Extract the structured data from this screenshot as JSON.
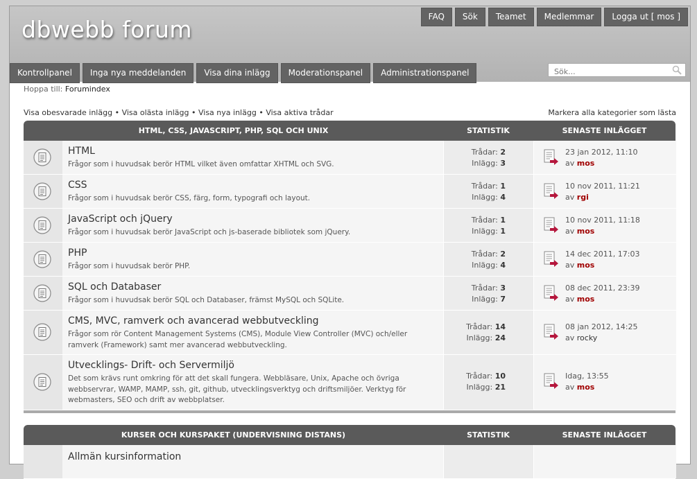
{
  "site": {
    "title": "dbwebb forum"
  },
  "top_nav": [
    {
      "label": "FAQ"
    },
    {
      "label": "Sök"
    },
    {
      "label": "Teamet"
    },
    {
      "label": "Medlemmar"
    },
    {
      "label": "Logga ut [ mos ]"
    }
  ],
  "tabs": [
    {
      "label": "Kontrollpanel"
    },
    {
      "label": "Inga nya meddelanden"
    },
    {
      "label": "Visa dina inlägg"
    },
    {
      "label": "Moderationspanel"
    },
    {
      "label": "Administrationspanel"
    }
  ],
  "search": {
    "placeholder": "Sök..."
  },
  "jump": {
    "prefix": "Hoppa till:",
    "link": "Forumindex"
  },
  "quick_links": [
    {
      "label": "Visa obesvarade inlägg"
    },
    {
      "label": "Visa olästa inlägg"
    },
    {
      "label": "Visa nya inlägg"
    },
    {
      "label": "Visa aktiva trådar"
    }
  ],
  "separator": "•",
  "mark_all": "Markera alla kategorier som lästa",
  "stat_labels": {
    "threads": "Trådar:",
    "posts": "Inlägg:",
    "by": "av"
  },
  "sections": [
    {
      "title": "HTML, CSS, JAVASCRIPT, PHP, SQL OCH UNIX",
      "stat_header": "STATISTIK",
      "last_header": "SENASTE INLÄGGET",
      "forums": [
        {
          "title": "HTML",
          "desc": "Frågor som i huvudsak berör HTML vilket även omfattar XHTML och SVG.",
          "threads": "2",
          "posts": "3",
          "last_date": "23 jan 2012, 11:10",
          "last_user": "mos"
        },
        {
          "title": "CSS",
          "desc": "Frågor som i huvudsak berör CSS, färg, form, typografi och layout.",
          "threads": "1",
          "posts": "4",
          "last_date": "10 nov 2011, 11:21",
          "last_user": "rgi"
        },
        {
          "title": "JavaScript och jQuery",
          "desc": "Frågor som i huvudsak berör JavaScript och js-baserade bibliotek som jQuery.",
          "threads": "1",
          "posts": "1",
          "last_date": "10 nov 2011, 11:18",
          "last_user": "mos"
        },
        {
          "title": "PHP",
          "desc": "Frågor som i huvudsak berör PHP.",
          "threads": "2",
          "posts": "4",
          "last_date": "14 dec 2011, 17:03",
          "last_user": "mos"
        },
        {
          "title": "SQL och Databaser",
          "desc": "Frågor som i huvudsak berör SQL och Databaser, främst MySQL och SQLite.",
          "threads": "3",
          "posts": "7",
          "last_date": "08 dec 2011, 23:39",
          "last_user": "mos"
        },
        {
          "title": "CMS, MVC, ramverk och avancerad webbutveckling",
          "desc": "Frågor som rör Content Management Systems (CMS), Module View Controller (MVC) och/eller ramverk (Framework) samt mer avancerad webbutveckling.",
          "threads": "14",
          "posts": "24",
          "last_date": "08 jan 2012, 14:25",
          "last_user": "rocky"
        },
        {
          "title": "Utvecklings- Drift- och Servermiljö",
          "desc": "Det som krävs runt omkring för att det skall fungera. Webbläsare, Unix, Apache och övriga webbservrar, WAMP, MAMP, ssh, git, github, utvecklingsverktyg och driftsmiljöer. Verktyg för webmasters, SEO och drift av webbplatser.",
          "threads": "10",
          "posts": "21",
          "last_date": "Idag, 13:55",
          "last_user": "mos"
        }
      ]
    },
    {
      "title": "KURSER OCH KURSPAKET (UNDERVISNING DISTANS)",
      "stat_header": "STATISTIK",
      "last_header": "SENASTE INLÄGGET",
      "forums": [
        {
          "title": "Allmän kursinformation"
        }
      ]
    }
  ]
}
